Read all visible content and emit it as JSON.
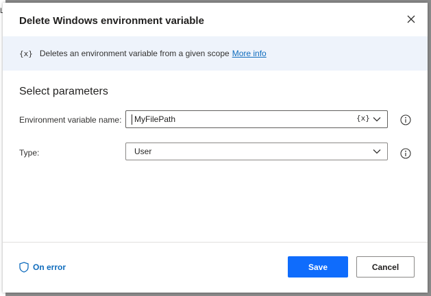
{
  "dialog": {
    "title": "Delete Windows environment variable",
    "close_icon": "close-icon"
  },
  "info": {
    "icon_text": "{x}",
    "text": "Deletes an environment variable from a given scope",
    "link_text": "More info"
  },
  "section_title": "Select parameters",
  "fields": {
    "variable_name": {
      "label": "Environment variable name:",
      "value": "MyFilePath",
      "fx_button": "{x}"
    },
    "type": {
      "label": "Type:",
      "value": "User"
    }
  },
  "footer": {
    "on_error_label": "On error",
    "save_label": "Save",
    "cancel_label": "Cancel"
  },
  "colors": {
    "accent": "#0f6cbd",
    "save_bg": "#0f6cfc",
    "info_bg": "#eef3fb"
  }
}
